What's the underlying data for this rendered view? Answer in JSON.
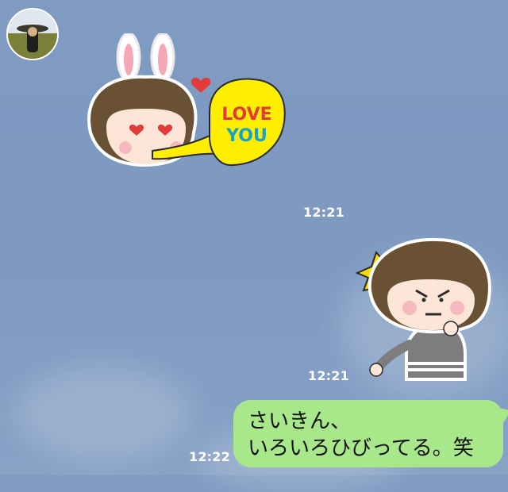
{
  "chat": {
    "incoming": {
      "sticker_1": {
        "speech": {
          "line1": "LOVE",
          "line2": "YOU"
        }
      },
      "timestamp": "12:21"
    },
    "outgoing": [
      {
        "type": "sticker",
        "timestamp": "12:21"
      },
      {
        "type": "text",
        "line1": "さいきん、",
        "line2": "いろいろひびってる。笑",
        "timestamp": "12:22"
      }
    ]
  },
  "colors": {
    "background": "#7f9bc2",
    "outgoing_bubble": "#a9e88a",
    "speech_yellow": "#ffee00",
    "love_red": "#e23b3b",
    "you_blue": "#16a3c8"
  },
  "icons": [
    "avatar",
    "sticker-girl-bunny-love",
    "sticker-girl-angry"
  ]
}
